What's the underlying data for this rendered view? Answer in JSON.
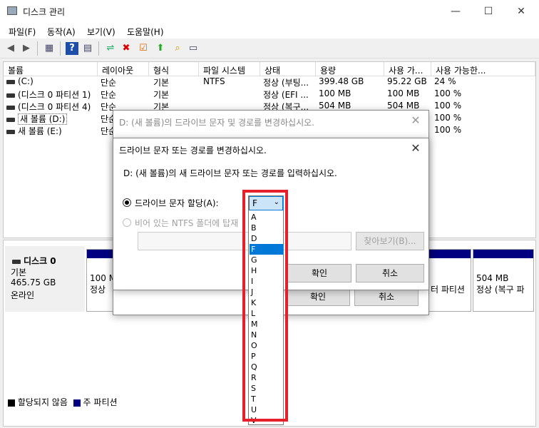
{
  "window": {
    "title": "디스크 관리",
    "controls": [
      "—",
      "☐",
      "✕"
    ]
  },
  "menu": [
    "파일(F)",
    "동작(A)",
    "보기(V)",
    "도움말(H)"
  ],
  "toolbar_icons": [
    "back-icon",
    "forward-icon",
    "console-icon",
    "help-icon",
    "properties-icon",
    "connect-icon",
    "delete-icon",
    "check-icon",
    "import-icon",
    "find-icon",
    "disk-icon"
  ],
  "volume_table": {
    "headers": [
      "볼륨",
      "레이아웃",
      "형식",
      "파일 시스템",
      "상태",
      "용량",
      "사용 가...",
      "사용 가능한..."
    ],
    "rows": [
      [
        "(C:)",
        "단순",
        "기본",
        "NTFS",
        "정상 (부팅...",
        "399.48 GB",
        "95.22 GB",
        "24 %"
      ],
      [
        "(디스크 0 파티션 1)",
        "단순",
        "기본",
        "",
        "정상 (EFI ...",
        "100 MB",
        "100 MB",
        "100 %"
      ],
      [
        "(디스크 0 파티션 4)",
        "단순",
        "기본",
        "",
        "정상 (복구...",
        "504 MB",
        "504 MB",
        "100 %"
      ],
      [
        "새 볼륨 (D:)",
        "단순",
        "",
        "",
        "",
        "",
        "",
        "100 %"
      ],
      [
        "새 볼륨 (E:)",
        "단순",
        "",
        "",
        "",
        "",
        "",
        "100 %"
      ]
    ]
  },
  "disk0": {
    "name": "디스크 0",
    "type": "기본",
    "size": "465.75 GB",
    "status": "온라인",
    "part_left": {
      "line1": "100 M",
      "line2": "정상"
    },
    "part_mid": {
      "line2": "터 파티션"
    },
    "part_right": {
      "line1": "504 MB",
      "line2": "정상 (복구 파"
    }
  },
  "legend": {
    "unallocated": "할당되지 않음",
    "primary": "주 파티션",
    "unallocated_color": "#000000",
    "primary_color": "#000080"
  },
  "outer_dialog": {
    "title": "D: (새 볼륨)의 드라이브 문자 및 경로를 변경하십시오.",
    "ok": "확인",
    "cancel": "취소"
  },
  "inner_dialog": {
    "title": "드라이브 문자 또는 경로를 변경하십시오.",
    "prompt": "D: (새 볼륨)의 새 드라이브 문자 또는 경로를 입력하십시오.",
    "assign_label": "드라이브 문자 할당(A):",
    "mount_label": "비어 있는 NTFS 폴더에 탑재",
    "browse": "찾아보기(B)...",
    "ok": "확인",
    "cancel": "취소"
  },
  "drive_letter": {
    "selected": "F",
    "options": [
      "A",
      "B",
      "D",
      "F",
      "G",
      "H",
      "I",
      "J",
      "K",
      "L",
      "M",
      "N",
      "O",
      "P",
      "Q",
      "R",
      "S",
      "T",
      "U",
      "V"
    ]
  }
}
